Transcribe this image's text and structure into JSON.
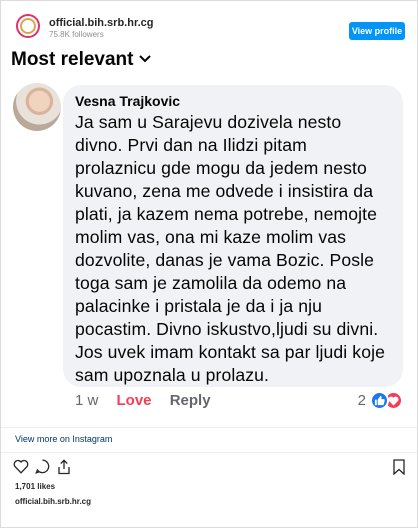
{
  "header": {
    "account_name": "official.bih.srb.hr.cg",
    "followers": "75.8K followers",
    "view_profile_label": "View profile"
  },
  "sort": {
    "label": "Most relevant",
    "chevron_icon": "chevron-down-icon"
  },
  "comment": {
    "author": "Vesna Trajkovic",
    "text": "Ja sam u Sarajevu dozivela nesto divno. Prvi dan na Ilidzi pitam prolaznicu gde mogu da jedem nesto kuvano, zena me odvede i insistira da plati, ja kazem nema potrebe, nemojte molim vas, ona mi kaze molim vas dozvolite, danas je vama Bozic. Posle toga sam je zamolila da odemo na palacinke i pristala je da i ja nju pocastim. Divno iskustvo,ljudi su divni. Jos uvek imam kontakt sa par ljudi koje sam upoznala u prolazu.",
    "time": "1 w",
    "love_label": "Love",
    "reply_label": "Reply",
    "reaction_count": "2",
    "reaction_icons": [
      "like-icon",
      "love-icon"
    ]
  },
  "footer": {
    "view_more_label": "View more on Instagram",
    "icons": [
      "heart-icon",
      "comment-icon",
      "share-icon",
      "bookmark-icon"
    ],
    "likes": "1,701 likes",
    "account_name": "official.bih.srb.hr.cg"
  },
  "colors": {
    "instagram_blue": "#0095f6",
    "bubble_bg": "#f0f2f5",
    "love_red": "#f33e58",
    "like_blue": "#1877f2"
  }
}
